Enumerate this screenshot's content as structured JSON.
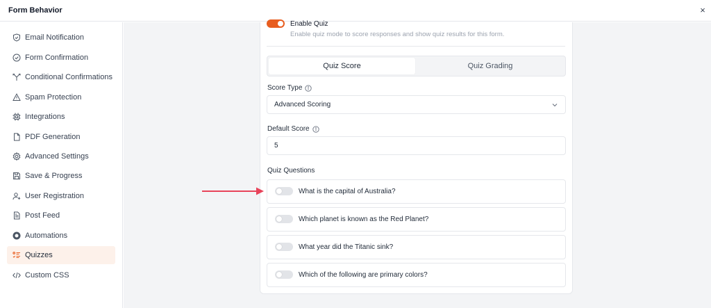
{
  "header": {
    "title": "Form Behavior",
    "close_label": "×"
  },
  "sidebar": {
    "items": [
      {
        "label": "Email Notification",
        "icon": "shield-check-icon"
      },
      {
        "label": "Form Confirmation",
        "icon": "check-circle-icon"
      },
      {
        "label": "Conditional Confirmations",
        "icon": "branch-icon"
      },
      {
        "label": "Spam Protection",
        "icon": "warning-icon"
      },
      {
        "label": "Integrations",
        "icon": "chip-icon"
      },
      {
        "label": "PDF Generation",
        "icon": "document-icon"
      },
      {
        "label": "Advanced Settings",
        "icon": "gear-icon"
      },
      {
        "label": "Save & Progress",
        "icon": "save-icon"
      },
      {
        "label": "User Registration",
        "icon": "user-plus-icon"
      },
      {
        "label": "Post Feed",
        "icon": "file-text-icon"
      },
      {
        "label": "Automations",
        "icon": "automation-icon"
      },
      {
        "label": "Quizzes",
        "icon": "list-check-icon",
        "active": true
      },
      {
        "label": "Custom CSS",
        "icon": "code-icon"
      }
    ]
  },
  "quiz": {
    "enable_title": "Enable Quiz",
    "enable_desc": "Enable quiz mode to score responses and show quiz results for this form.",
    "enabled": true,
    "tabs": [
      {
        "label": "Quiz Score",
        "active": true
      },
      {
        "label": "Quiz Grading",
        "active": false
      }
    ],
    "score_type_label": "Score Type",
    "score_type_value": "Advanced Scoring",
    "default_score_label": "Default Score",
    "default_score_value": "5",
    "questions_label": "Quiz Questions",
    "questions": [
      {
        "text": "What is the capital of Australia?",
        "enabled": false
      },
      {
        "text": "Which planet is known as the Red Planet?",
        "enabled": false
      },
      {
        "text": "What year did the Titanic sink?",
        "enabled": false
      },
      {
        "text": "Which of the following are primary colors?",
        "enabled": false
      }
    ]
  },
  "colors": {
    "accent": "#e85d1f",
    "active_bg": "#fdf1ea",
    "arrow": "#e8435a"
  }
}
